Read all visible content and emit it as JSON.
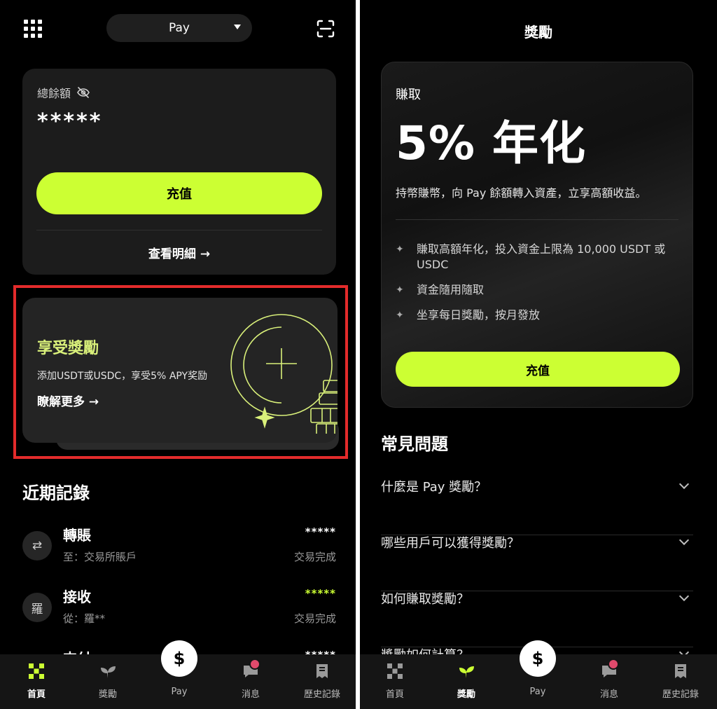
{
  "left": {
    "app_select": {
      "value": "Pay"
    },
    "balance": {
      "label": "總餘額",
      "value": "*****",
      "deposit_label": "充值",
      "details_label": "查看明細 →"
    },
    "promo": {
      "title": "享受獎勵",
      "description": "添加USDT或USDC，享受5% APY奖励",
      "link": "瞭解更多 →"
    },
    "recent": {
      "title": "近期記錄",
      "items": [
        {
          "avatar": "⇄",
          "title": "轉賬",
          "sub": "至：交易所賬戶",
          "amount": "*****",
          "status": "交易完成",
          "amount_color": "#ffffff"
        },
        {
          "avatar": "羅",
          "title": "接收",
          "sub": "從：羅**",
          "amount": "*****",
          "status": "交易完成",
          "amount_color": "#ccff33"
        },
        {
          "avatar": "",
          "title": "支付",
          "sub": "",
          "amount": "*****",
          "status": "",
          "amount_color": "#ffffff"
        }
      ]
    },
    "nav": [
      {
        "label": "首頁",
        "icon": "home-grid-icon",
        "active": true
      },
      {
        "label": "獎勵",
        "icon": "sprout-icon",
        "active": false
      },
      {
        "label": "Pay",
        "icon": "dollar-icon",
        "active": false
      },
      {
        "label": "消息",
        "icon": "chat-icon",
        "active": false
      },
      {
        "label": "歷史記錄",
        "icon": "receipt-icon",
        "active": false
      }
    ],
    "pay_symbol": "$"
  },
  "right": {
    "title": "獎勵",
    "earn": {
      "eyebrow": "賺取",
      "headline": "5% 年化",
      "description": "持幣賺幣，向 Pay 餘額轉入資產，立享高額收益。",
      "benefits": [
        "賺取高額年化，投入資金上限為 10,000 USDT 或 USDC",
        "資金隨用隨取",
        "坐享每日獎勵，按月發放"
      ],
      "deposit_label": "充值"
    },
    "faq": {
      "title": "常見問題",
      "items": [
        "什麼是 Pay 獎勵？",
        "哪些用戶可以獲得獎勵？",
        "如何賺取獎勵？",
        "獎勵如何計算？"
      ]
    },
    "nav": [
      {
        "label": "首頁",
        "icon": "home-grid-icon",
        "active": false
      },
      {
        "label": "獎勵",
        "icon": "sprout-icon",
        "active": true
      },
      {
        "label": "Pay",
        "icon": "dollar-icon",
        "active": false
      },
      {
        "label": "消息",
        "icon": "chat-icon",
        "active": false
      },
      {
        "label": "歷史記錄",
        "icon": "receipt-icon",
        "active": false
      }
    ],
    "pay_symbol": "$"
  },
  "colors": {
    "accent": "#ccff33",
    "highlight_border": "#e32b2b",
    "badge": "#e04a6c"
  }
}
